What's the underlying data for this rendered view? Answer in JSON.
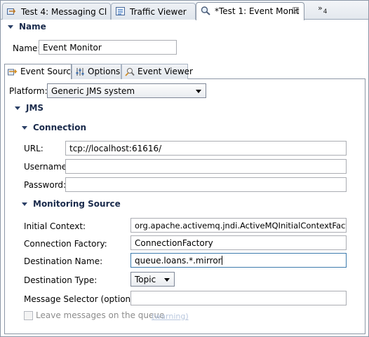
{
  "editor_tabs": [
    {
      "label": "Test 4: Messaging Cl",
      "icon": "test-icon"
    },
    {
      "label": "Traffic Viewer",
      "icon": "traffic-icon"
    },
    {
      "label": "*Test 1: Event Monit",
      "icon": "magnifier-icon"
    }
  ],
  "overflow": {
    "symbol": "»",
    "count": "4"
  },
  "name_section": {
    "header": "Name",
    "label": "Name:",
    "value": "Event Monitor"
  },
  "inner_tabs": [
    {
      "label": "Event Source",
      "icon": "event-source-icon"
    },
    {
      "label": "Options",
      "icon": "options-icon"
    },
    {
      "label": "Event Viewer",
      "icon": "event-viewer-icon"
    }
  ],
  "platform": {
    "label": "Platform:",
    "value": "Generic JMS system"
  },
  "jms": {
    "header": "JMS"
  },
  "connection": {
    "header": "Connection",
    "url_label": "URL:",
    "url_value": "tcp://localhost:61616/",
    "username_label": "Username:",
    "username_value": "",
    "password_label": "Password:",
    "password_value": ""
  },
  "monitoring": {
    "header": "Monitoring Source",
    "initial_context_label": "Initial Context:",
    "initial_context_value": "org.apache.activemq.jndi.ActiveMQInitialContextFactory",
    "connection_factory_label": "Connection Factory:",
    "connection_factory_value": "ConnectionFactory",
    "destination_name_label": "Destination Name:",
    "destination_name_value": "queue.loans.*.mirror",
    "destination_type_label": "Destination Type:",
    "destination_type_value": "Topic",
    "message_selector_label": "Message Selector (optional):",
    "message_selector_value": "",
    "leave_messages_label": "Leave messages on the queue",
    "warning_link": "(warning)"
  }
}
